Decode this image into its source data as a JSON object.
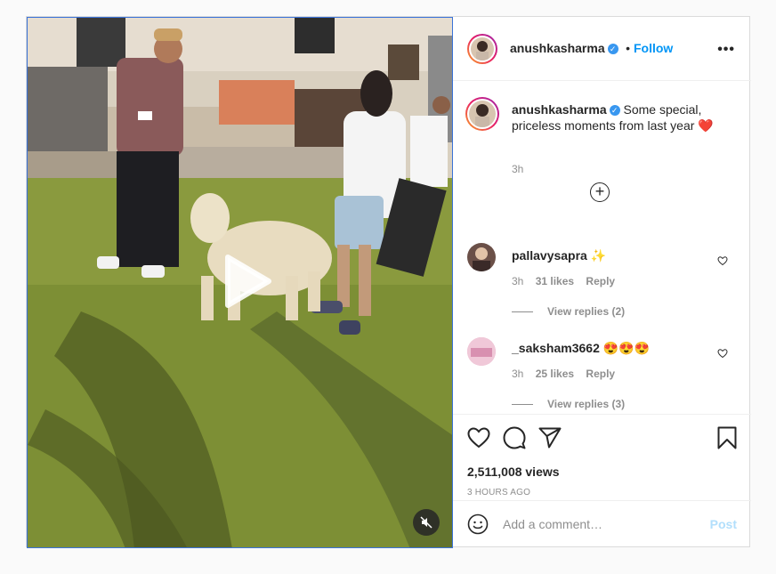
{
  "post": {
    "author": "anushkasharma",
    "follow_label": "Follow",
    "separator": "•",
    "more_label": "•••",
    "caption": "Some special, priceless moments from last year ❤️",
    "caption_time": "3h",
    "load_more_icon": "plus-circle-icon",
    "comments": [
      {
        "user": "pallavysapra",
        "text": "✨",
        "time": "3h",
        "likes": "31 likes",
        "reply_label": "Reply",
        "view_replies": "View replies (2)"
      },
      {
        "user": "_saksham3662",
        "text": "😍😍😍",
        "time": "3h",
        "likes": "25 likes",
        "reply_label": "Reply",
        "view_replies": "View replies (3)"
      }
    ],
    "views": "2,511,008 views",
    "posted_ago": "3 HOURS AGO",
    "add_comment_placeholder": "Add a comment…",
    "post_label": "Post"
  },
  "colors": {
    "follow": "#0095f6",
    "verified": "#3897f0",
    "post_disabled": "#b2dffc"
  }
}
